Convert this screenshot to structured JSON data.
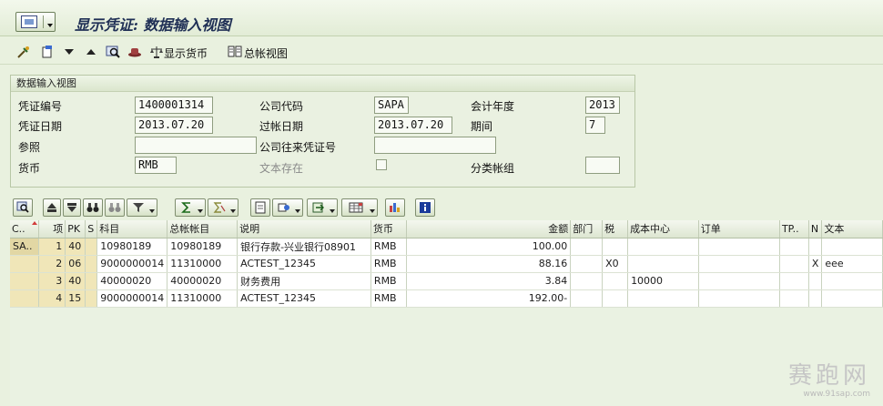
{
  "window": {
    "title": "显示凭证: 数据输入视图"
  },
  "toolbar": {
    "show_currency_label": "显示货币",
    "gl_view_label": "总帐视图"
  },
  "header": {
    "section_title": "数据输入视图",
    "doc_number_label": "凭证编号",
    "doc_number_value": "1400001314",
    "company_code_label": "公司代码",
    "company_code_value": "SAPA",
    "fiscal_year_label": "会计年度",
    "fiscal_year_value": "2013",
    "doc_date_label": "凭证日期",
    "doc_date_value": "2013.07.20",
    "posting_date_label": "过帐日期",
    "posting_date_value": "2013.07.20",
    "period_label": "期间",
    "period_value": "7",
    "reference_label": "参照",
    "reference_value": "",
    "intercompany_label": "公司往来凭证号",
    "intercompany_value": "",
    "currency_label": "货币",
    "currency_value": "RMB",
    "text_exists_label": "文本存在",
    "ledger_group_label": "分类帐组",
    "ledger_group_value": ""
  },
  "grid": {
    "columns": [
      "C..",
      "项",
      "PK",
      "S",
      "科目",
      "总帐帐目",
      "说明",
      "货币",
      "金额",
      "部门",
      "税",
      "成本中心",
      "订单",
      "TP..",
      "N",
      "文本"
    ],
    "rows": [
      [
        "SA..",
        "1",
        "40",
        "",
        "10980189",
        "10980189",
        "银行存款-兴业银行08901",
        "RMB",
        "100.00",
        "",
        "",
        "",
        "",
        "",
        "",
        ""
      ],
      [
        "",
        "2",
        "06",
        "",
        "9000000014",
        "11310000",
        "ACTEST_12345",
        "RMB",
        "88.16",
        "",
        "X0",
        "",
        "",
        "",
        "X",
        "eee"
      ],
      [
        "",
        "3",
        "40",
        "",
        "40000020",
        "40000020",
        "财务费用",
        "RMB",
        "3.84",
        "",
        "",
        "10000",
        "",
        "",
        "",
        ""
      ],
      [
        "",
        "4",
        "15",
        "",
        "9000000014",
        "11310000",
        "ACTEST_12345",
        "RMB",
        "192.00-",
        "",
        "",
        "",
        "",
        "",
        "",
        ""
      ]
    ]
  },
  "watermark": {
    "text": "赛跑网",
    "url": "www.91sap.com"
  },
  "colors": {
    "background": "#e9f1df",
    "title": "#1f2f55",
    "key_cell": "#f0e6b8"
  }
}
